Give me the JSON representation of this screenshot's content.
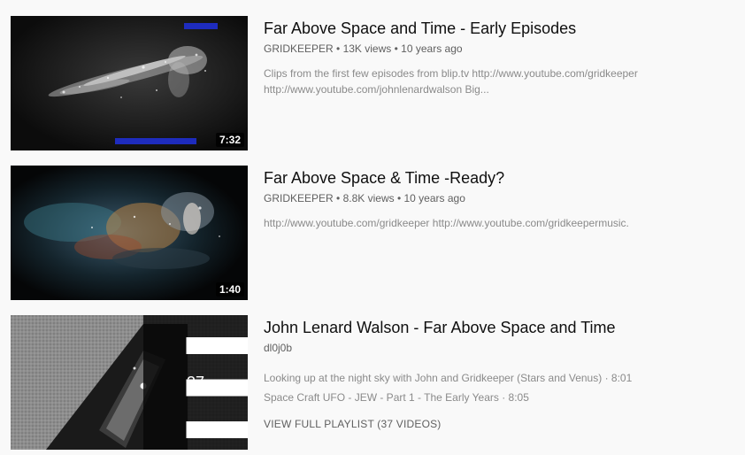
{
  "results": [
    {
      "title": "Far Above Space and Time - Early Episodes",
      "channel": "GRIDKEEPER",
      "views": "13K views",
      "age": "10 years ago",
      "description_lines": [
        "Clips from the first few episodes from blip.tv http://www.youtube.com/gridkeeper",
        "http://www.youtube.com/johnlenardwalson Big..."
      ],
      "duration": "7:32"
    },
    {
      "title": "Far Above Space & Time -Ready?",
      "channel": "GRIDKEEPER",
      "views": "8.8K views",
      "age": "10 years ago",
      "description_lines": [
        "http://www.youtube.com/gridkeeper http://www.youtube.com/gridkeepermusic."
      ],
      "duration": "1:40"
    }
  ],
  "playlist": {
    "title": "John Lenard Walson - Far Above Space and Time",
    "channel": "dl0j0b",
    "video_count": "37",
    "items": [
      "Looking up at the night sky with John and Gridkeeper (Stars and Venus) · 8:01",
      "Space Craft UFO - JEW - Part 1 - The Early Years · 8:05"
    ],
    "view_full_label": "VIEW FULL PLAYLIST (37 VIDEOS)"
  },
  "separator": "•",
  "icons": [
    "playlist-queue-icon"
  ]
}
